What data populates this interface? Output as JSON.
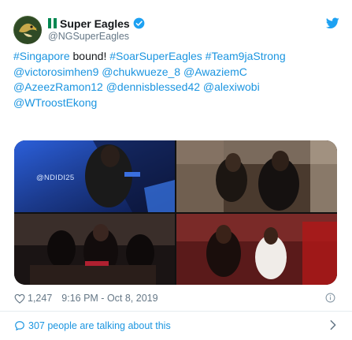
{
  "tweet": {
    "display_name": "Super Eagles",
    "handle": "@NGSuperEagles",
    "text_parts": [
      {
        "text": "#Singapore",
        "link": true
      },
      {
        "text": " bound! ",
        "link": false
      },
      {
        "text": "#SoarSuperEagles",
        "link": true
      },
      {
        "text": " ",
        "link": false
      },
      {
        "text": "#Team9jaStrong",
        "link": true
      },
      {
        "text": " ",
        "link": false
      },
      {
        "text": "@victorosimhen9",
        "link": true
      },
      {
        "text": " ",
        "link": false
      },
      {
        "text": "@chukwueze_8",
        "link": true
      },
      {
        "text": " ",
        "link": false
      },
      {
        "text": "@AwaziemC",
        "link": true
      },
      {
        "text": " ",
        "link": false
      },
      {
        "text": "@AzeezRamon12",
        "link": true
      },
      {
        "text": " ",
        "link": false
      },
      {
        "text": "@dennisblessed42",
        "link": true
      },
      {
        "text": " ",
        "link": false
      },
      {
        "text": "@alexiwobi",
        "link": true
      },
      {
        "text": " ",
        "link": false
      },
      {
        "text": "@WTroostEkong",
        "link": true
      }
    ],
    "media_watermark": "@NDIDI25",
    "likes": "1,247",
    "timestamp": "9:16 PM - Oct 8, 2019",
    "talking_label": "307 people are talking about this"
  },
  "icons": {
    "avatar": "super-eagles-logo-icon",
    "flag": "nigeria-flag-icon",
    "verified": "verified-badge-icon",
    "platform": "twitter-bird-icon",
    "like": "heart-icon",
    "info": "info-icon",
    "conversation": "speech-bubble-icon",
    "more": "chevron-right-icon"
  },
  "colors": {
    "link": "#1b95e0",
    "secondary_text": "#657786",
    "primary_text": "#14171a",
    "verified": "#1da1f2",
    "flag_green": "#008751"
  }
}
